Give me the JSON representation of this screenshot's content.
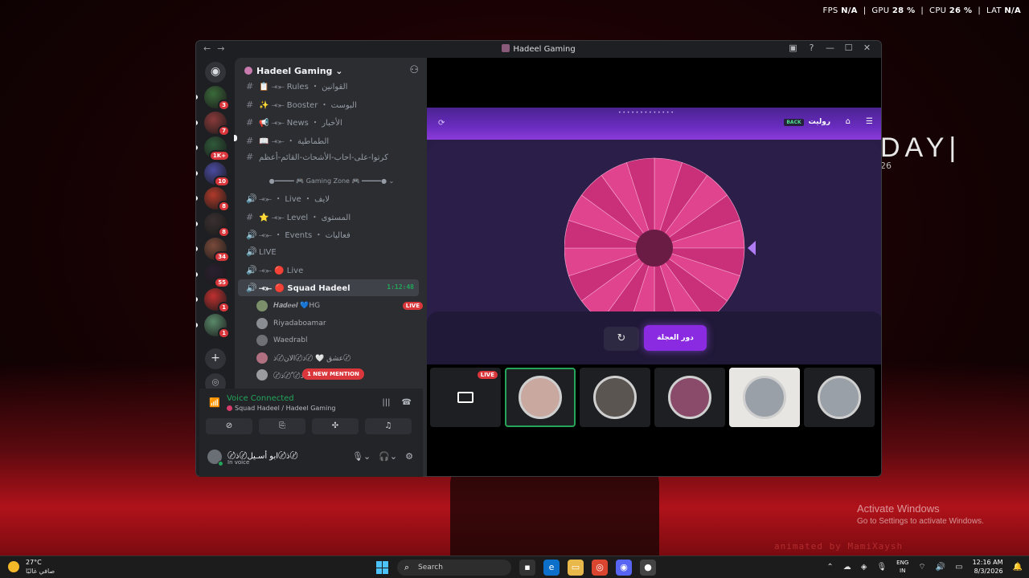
{
  "overlay": {
    "fps_label": "FPS",
    "fps": "N/A",
    "gpu_label": "GPU",
    "gpu": "28 %",
    "cpu_label": "CPU",
    "cpu": "26 %",
    "lat_label": "LAT",
    "lat": "N/A"
  },
  "desktop": {
    "clock_text": "DAY|",
    "clock_sub": "26",
    "activate_title": "Activate Windows",
    "activate_sub": "Go to Settings to activate Windows.",
    "animated": "animated by MamiXaysh"
  },
  "window": {
    "title": "Hadeel Gaming",
    "back_icon": "arrow-left-icon",
    "forward_icon": "arrow-right-icon"
  },
  "guild": {
    "name": "Hadeel Gaming ⌄"
  },
  "channels": [
    {
      "sym": "#",
      "label": "📋 ⤛⤜ Rules ・ القوانين"
    },
    {
      "sym": "#",
      "label": "✨ ⤛⤜ Booster ・ البوست"
    },
    {
      "sym": "#",
      "label": "📢 ⤛⤜ News ・ الأخبار"
    },
    {
      "sym": "#",
      "label": "📖 ⤛⤜ ・ الطماطية"
    },
    {
      "sym": "#",
      "label": "كرتوا-على-احاب-الأشحاث-القائم-أعظم"
    }
  ],
  "category": {
    "label": "●━━━━━ 🎮 Gaming Zone 🎮 ━━━━━● ⌄"
  },
  "channels2": [
    {
      "sym": "🔊",
      "label": "⤛⤜ ・ Live ・ لايف"
    },
    {
      "sym": "#",
      "label": "⭐ ⤛⤜ Level ・ المستوى"
    },
    {
      "sym": "🔊",
      "label": "⤛⤜ ・ Events ・ فعاليات"
    },
    {
      "sym": "🔊",
      "label": "LIVE"
    },
    {
      "sym": "🔊",
      "label": "⤛⤜ 🔴 Live"
    }
  ],
  "active_channel": {
    "sym": "🔊",
    "label": "⤛⤜ 🔴 Squad Hadeel",
    "timer": "1:12:48"
  },
  "voice_members": [
    {
      "name": "𝑯𝒂𝒅𝒆𝒆𝒍 💙HG",
      "live": "LIVE",
      "color": "#7a8f6a"
    },
    {
      "name": "Riyadaboamar",
      "live": "",
      "color": "#8a8d92"
    },
    {
      "name": "Waedrabl",
      "live": "",
      "color": "#6e7076"
    },
    {
      "name": "عشق 🤍 〄ذ〄الان〄ذ〄",
      "live": "",
      "color": "#b07080"
    },
    {
      "name": "〄ذ〄 ّ〄ذ〄 ّ KS",
      "live": "",
      "color": "#9a9ca0"
    }
  ],
  "mention": "1 NEW MENTION",
  "voice": {
    "title": "Voice Connected",
    "sub": "Squad Hadeel / Hadeel Gaming"
  },
  "voice_buttons": [
    {
      "name": "camera-off-icon",
      "glyph": "⊘"
    },
    {
      "name": "screen-share-icon",
      "glyph": "⎘"
    },
    {
      "name": "activities-icon",
      "glyph": "✣"
    },
    {
      "name": "soundboard-icon",
      "glyph": "♫"
    }
  ],
  "user": {
    "name": "〄ذ〄ابو أسـيل〄ذ〄",
    "status": "In voice"
  },
  "game": {
    "url": "• • • • • • • • • • • • •",
    "brand": "روليت",
    "brand_logo": "BACK",
    "spin_label": "دور العجلة",
    "reset_icon": "↻"
  },
  "wheel": {
    "segments": 20,
    "colors": [
      "#e0448e",
      "#c93079"
    ],
    "center_color": "#6a1c45",
    "pointer_color": "#b07cf5"
  },
  "tiles": [
    {
      "kind": "screen",
      "live": "LIVE"
    },
    {
      "kind": "avatar",
      "selected": true,
      "color": "#c9a8a0"
    },
    {
      "kind": "avatar",
      "color": "#5a5550"
    },
    {
      "kind": "avatar",
      "color": "#8a4a6a"
    },
    {
      "kind": "avatar",
      "light": true,
      "color": "#9aa0a8"
    },
    {
      "kind": "avatar",
      "color": "#9aa0a8"
    }
  ],
  "servers": [
    {
      "badge": "3",
      "color": "#3b6a3a"
    },
    {
      "badge": "7",
      "color": "#8a3a3a"
    },
    {
      "badge": "1K+",
      "color": "#2f5a3a"
    },
    {
      "badge": "10",
      "color": "#4a4aa0"
    },
    {
      "badge": "8",
      "color": "#b03a2a"
    },
    {
      "badge": "8",
      "color": "#3a3030"
    },
    {
      "badge": "34",
      "color": "#7a4a3a"
    },
    {
      "badge": "55",
      "color": "#2a2030"
    },
    {
      "badge": "1",
      "color": "#c03030"
    },
    {
      "badge": "1",
      "color": "#5a8a6a"
    }
  ],
  "taskbar": {
    "temp": "27°C",
    "weather": "صافي غالبًا",
    "search": "Search",
    "lang1": "ENG",
    "lang2": "IN",
    "time": "12:16 AM",
    "date": "8/3/2026"
  }
}
